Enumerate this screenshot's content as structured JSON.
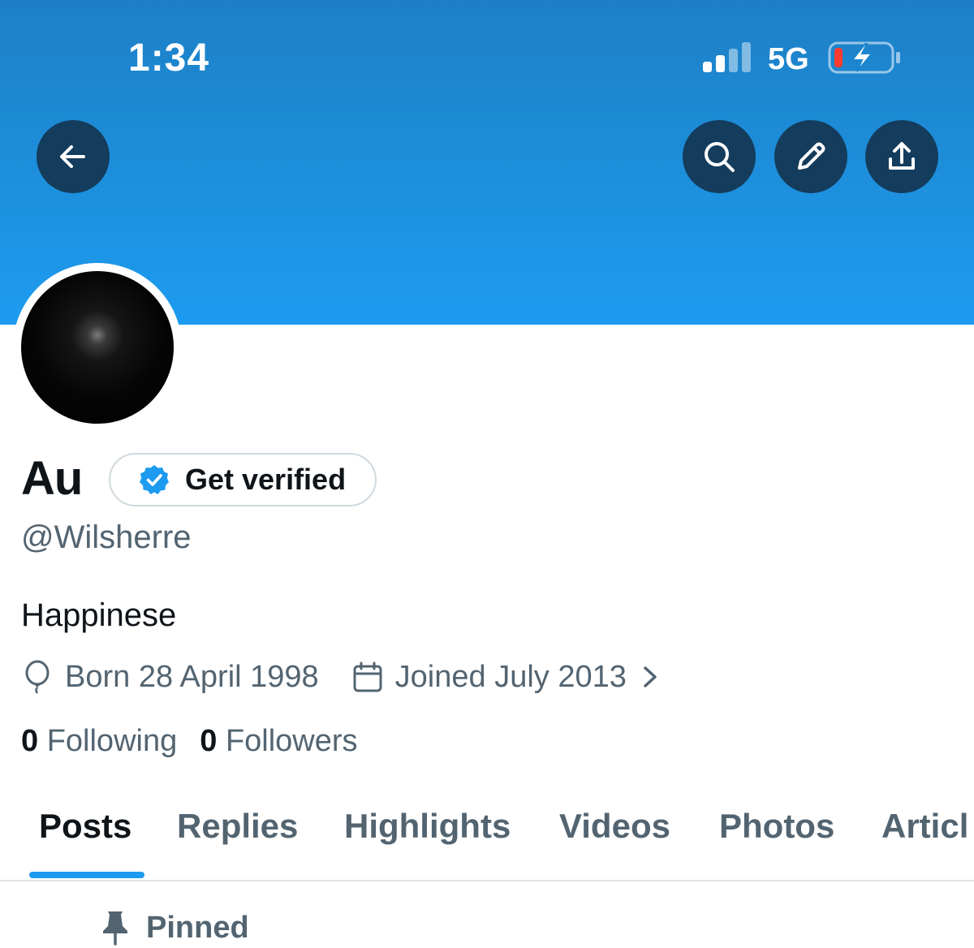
{
  "status_bar": {
    "time": "1:34",
    "network": "5G",
    "battery_state": "low, charging",
    "signal_icon": "cellular-signal-icon",
    "battery_icon": "battery-charging-icon"
  },
  "header": {
    "banner_color": "#1d9bf0",
    "back_icon": "arrow-left-icon",
    "search_icon": "search-icon",
    "edit_icon": "pencil-icon",
    "share_icon": "share-upload-icon"
  },
  "profile": {
    "name": "Au",
    "get_verified_label": "Get verified",
    "verified_badge_icon": "verified-badge-icon",
    "handle": "@Wilsherre",
    "bio": "Happinese",
    "born": "Born 28 April 1998",
    "joined": "Joined July 2013",
    "following_count": "0",
    "following_label": "Following",
    "followers_count": "0",
    "followers_label": "Followers"
  },
  "tabs": [
    {
      "label": "Posts",
      "active": true
    },
    {
      "label": "Replies",
      "active": false
    },
    {
      "label": "Highlights",
      "active": false
    },
    {
      "label": "Videos",
      "active": false
    },
    {
      "label": "Photos",
      "active": false
    },
    {
      "label": "Articl",
      "active": false
    }
  ],
  "pinned": {
    "label": "Pinned",
    "icon": "pin-icon"
  },
  "colors": {
    "accent": "#1d9bf0",
    "text_primary": "#0f1419",
    "text_secondary": "#536471",
    "button_dark": "#143c5c"
  }
}
